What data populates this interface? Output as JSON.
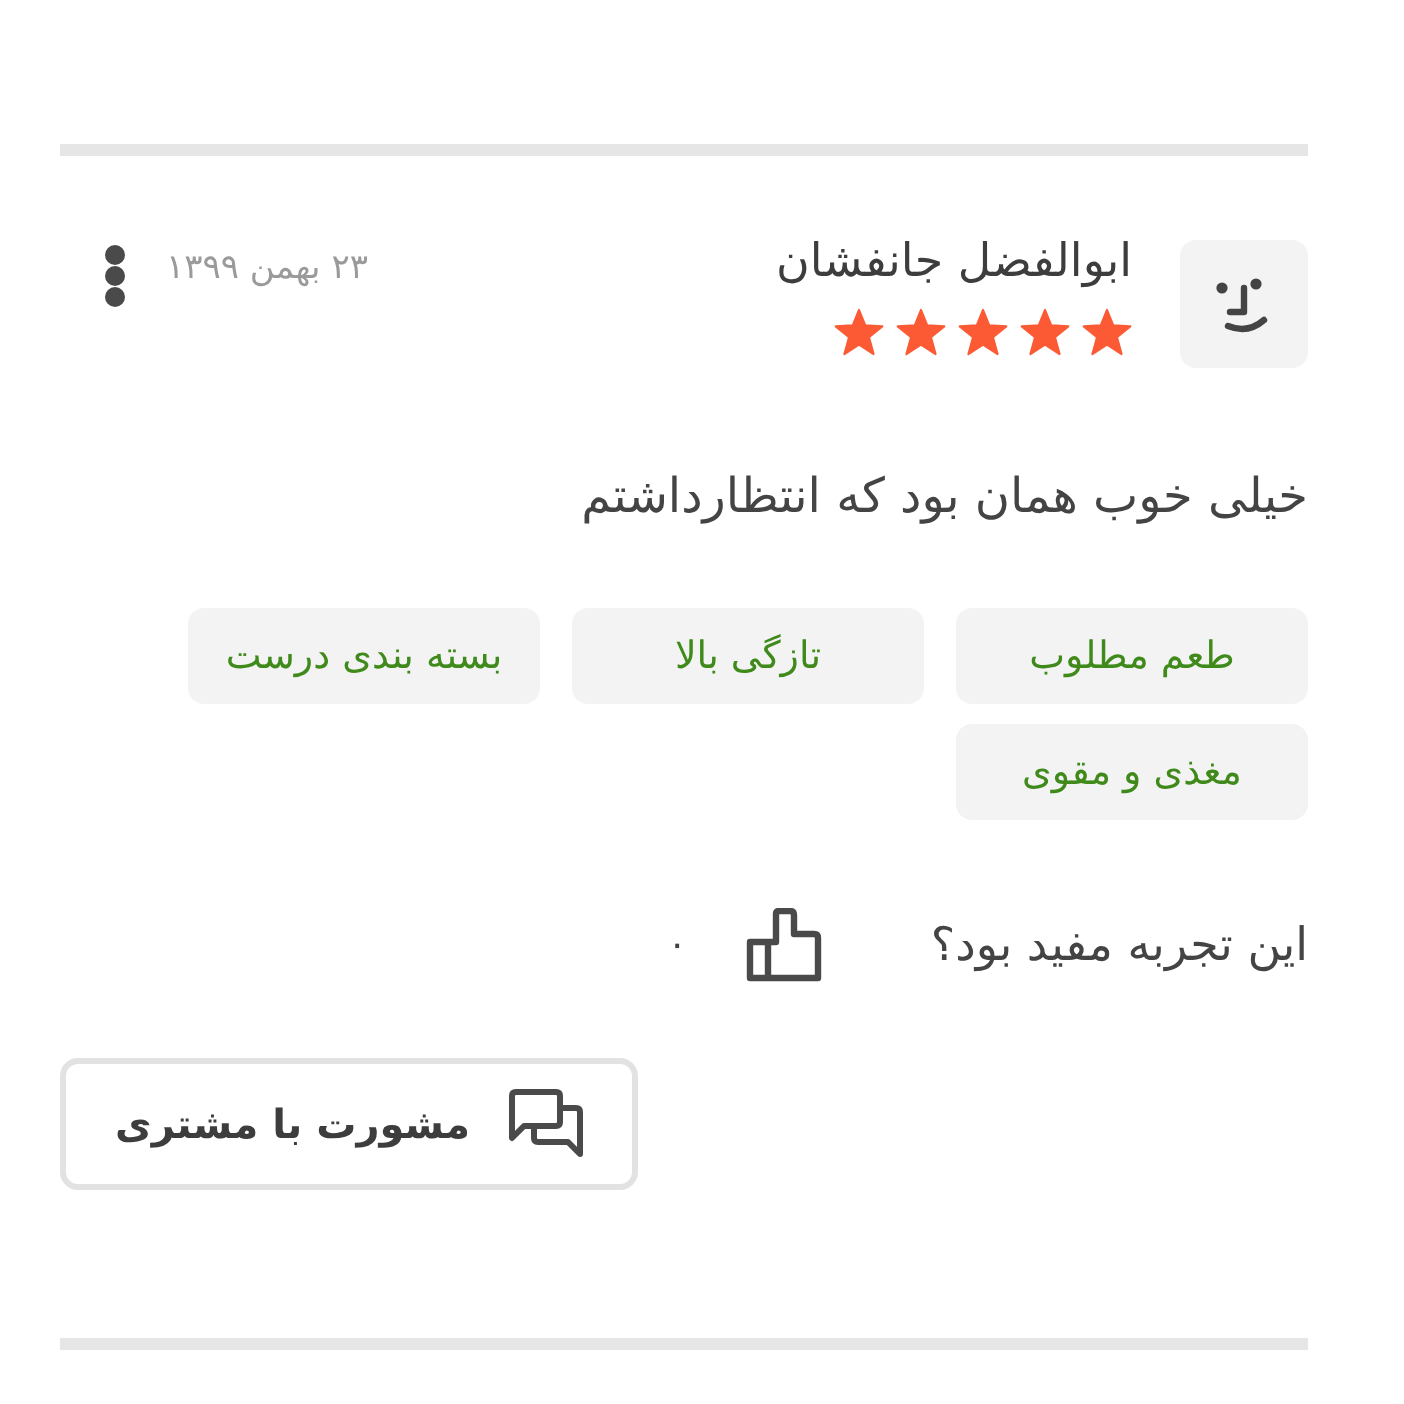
{
  "review": {
    "author": "ابوالفضل جانفشان",
    "stars": 5,
    "date": "۲۳ بهمن ۱۳۹۹",
    "text": "خیلی خوب همان بود که انتظارداشتم",
    "tags": [
      "طعم مطلوب",
      "تازگی بالا",
      "بسته بندی درست",
      "مغذی و مقوی"
    ],
    "helpful": {
      "question": "این تجربه مفید بود؟",
      "count": "۰"
    },
    "consult_button": "مشورت با مشتری"
  }
}
